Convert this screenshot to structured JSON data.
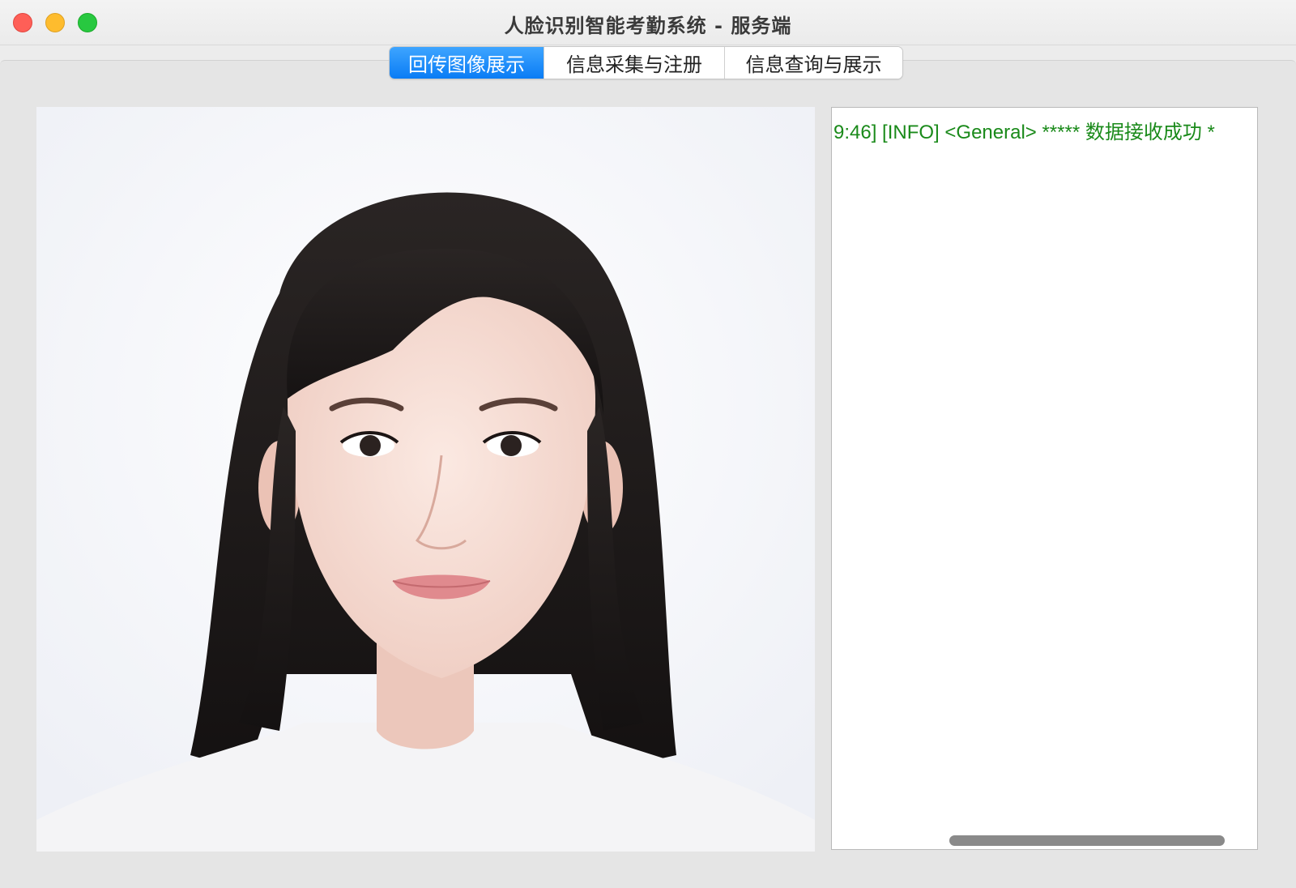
{
  "window": {
    "title": "人脸识别智能考勤系统 - 服务端"
  },
  "tabs": [
    {
      "label": "回传图像展示",
      "active": true
    },
    {
      "label": "信息采集与注册",
      "active": false
    },
    {
      "label": "信息查询与展示",
      "active": false
    }
  ],
  "image_panel": {
    "content": "returned face photo"
  },
  "log": {
    "lines": [
      "9:46] [INFO] <General> ***** 数据接收成功 *"
    ],
    "text_color": "#1a8a1a"
  },
  "colors": {
    "tab_active": "#0a7cf5",
    "traffic_close": "#fe5f57",
    "traffic_minimize": "#febc2e",
    "traffic_zoom": "#28c840"
  }
}
